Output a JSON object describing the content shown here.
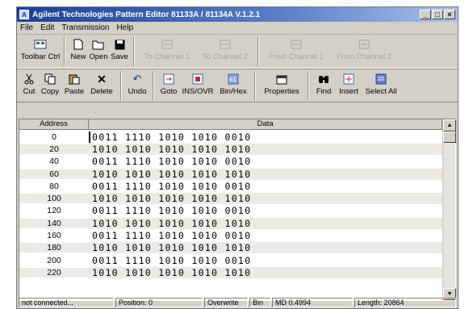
{
  "window": {
    "title": "Agilent Technologies Pattern Editor 81133A / 81134A V.1.2.1",
    "controls": [
      "_",
      "□",
      "×"
    ]
  },
  "menu": [
    "File",
    "Edit",
    "Transmission",
    "Help"
  ],
  "toolbar1": [
    {
      "label": "Toolbar Ctrl",
      "icon": "toolbar-ctrl-icon",
      "enabled": true
    },
    {
      "label": "New",
      "icon": "new-file-icon",
      "enabled": true
    },
    {
      "label": "Open",
      "icon": "open-folder-icon",
      "enabled": true
    },
    {
      "label": "Save",
      "icon": "save-disk-icon",
      "enabled": true
    },
    {
      "label": "To Channel 1",
      "icon": "to-channel-icon",
      "enabled": false
    },
    {
      "label": "To Channel 2",
      "icon": "to-channel-icon",
      "enabled": false
    },
    {
      "label": "From Channel 1",
      "icon": "from-channel-icon",
      "enabled": false
    },
    {
      "label": "From Channel 2",
      "icon": "from-channel-icon",
      "enabled": false
    }
  ],
  "toolbar2": [
    {
      "label": "Cut",
      "icon": "scissors-icon"
    },
    {
      "label": "Copy",
      "icon": "copy-icon"
    },
    {
      "label": "Paste",
      "icon": "paste-icon"
    },
    {
      "label": "Delete",
      "icon": "delete-x-icon"
    },
    {
      "label": "Undo",
      "icon": "undo-arrow-icon"
    },
    {
      "label": "Goto",
      "icon": "goto-icon"
    },
    {
      "label": "INS/OVR",
      "icon": "ins-ovr-icon"
    },
    {
      "label": "Bin/Hex",
      "icon": "bin-hex-icon"
    },
    {
      "label": "Properties",
      "icon": "properties-icon"
    },
    {
      "label": "Find",
      "icon": "binoculars-icon"
    },
    {
      "label": "Insert",
      "icon": "insert-icon"
    },
    {
      "label": "Select All",
      "icon": "select-all-icon"
    }
  ],
  "grid": {
    "headers": {
      "address": "Address",
      "data": "Data"
    },
    "rows": [
      {
        "address": "0",
        "data": "0011 1110 1010 1010 0010"
      },
      {
        "address": "20",
        "data": "1010 1010 1010 1010 1010"
      },
      {
        "address": "40",
        "data": "0011 1110 1010 1010 0010"
      },
      {
        "address": "60",
        "data": "1010 1010 1010 1010 1010"
      },
      {
        "address": "80",
        "data": "0011 1110 1010 1010 0010"
      },
      {
        "address": "100",
        "data": "1010 1010 1010 1010 1010"
      },
      {
        "address": "120",
        "data": "0011 1110 1010 1010 0010"
      },
      {
        "address": "140",
        "data": "1010 1010 1010 1010 1010"
      },
      {
        "address": "160",
        "data": "0011 1110 1010 1010 0010"
      },
      {
        "address": "180",
        "data": "1010 1010 1010 1010 1010"
      },
      {
        "address": "200",
        "data": "0011 1110 1010 1010 0010"
      },
      {
        "address": "220",
        "data": "1010 1010 1010 1010 1010"
      }
    ]
  },
  "status": {
    "connection": "not connected...",
    "position": "Position: 0",
    "mode": "Overwrite",
    "format": "Bin",
    "md": "MD 0.4994",
    "length": "Length: 20864"
  }
}
